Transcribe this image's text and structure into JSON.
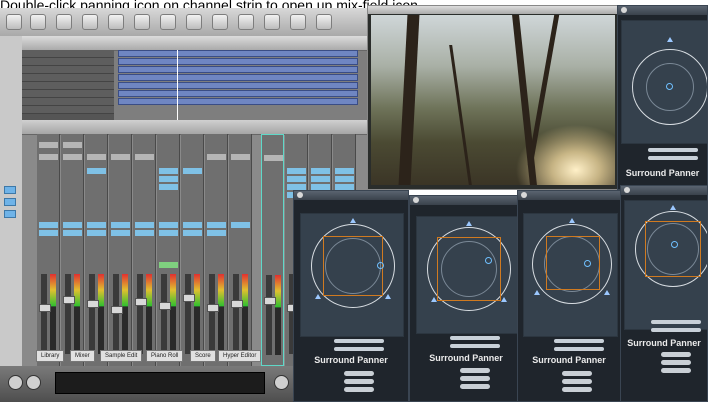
{
  "caption": "Double-click panning icon on channel strip to open up mix-field icon.",
  "panner": {
    "title": "Surround Panner"
  },
  "tabs": [
    "Library",
    "Mixer",
    "Sample Edit",
    "Piano Roll",
    "Score",
    "Hyper Editor"
  ]
}
